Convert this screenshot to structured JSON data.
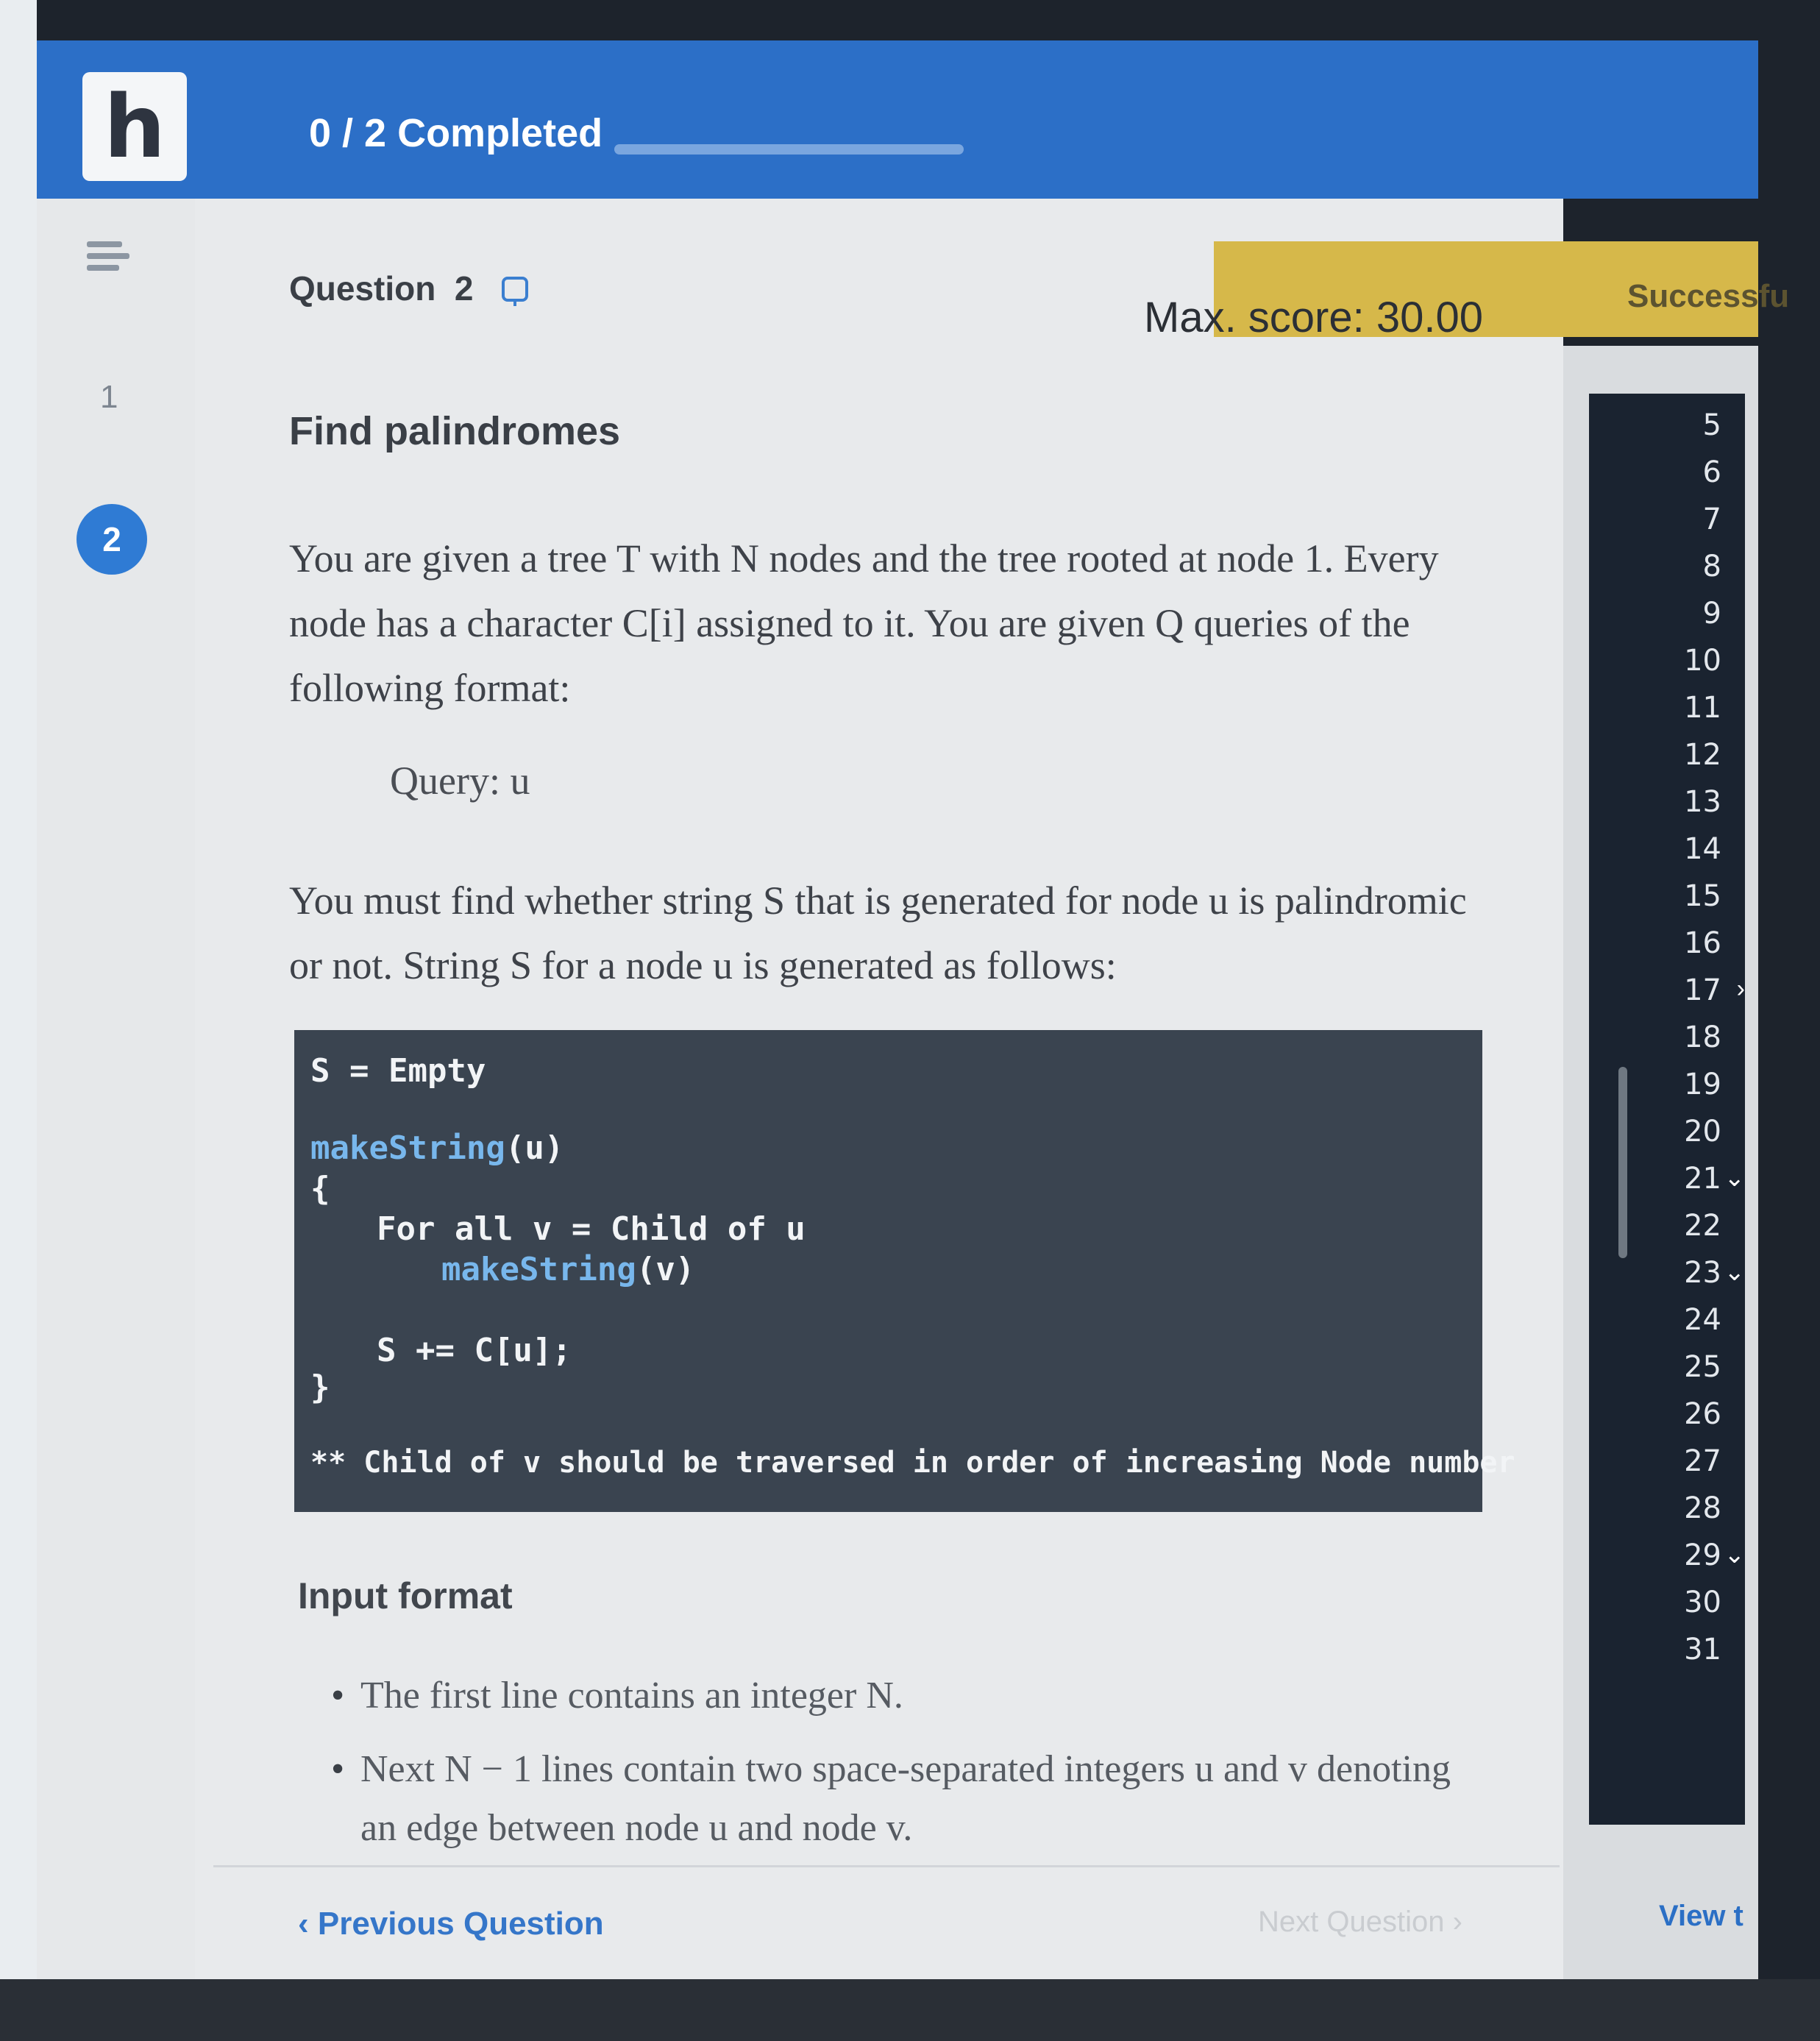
{
  "header": {
    "logo_letter": "h",
    "progress_label": "0 / 2 Completed",
    "progress_fraction": 0.0
  },
  "nav": {
    "questions": [
      "1",
      "2"
    ],
    "active_index": 1
  },
  "question": {
    "label": "Question",
    "number": "2",
    "max_score": "Max. score: 30.00",
    "status": "Successfu",
    "title": "Find palindromes",
    "para1": "You are given a tree T with N nodes and the tree rooted at node 1. Every node has a character C[i] assigned to it. You are given Q queries of the following format:",
    "query": "Query: u",
    "para2": "You must find whether string S that is generated for node u is palindromic or not. String S for a node u is generated as follows:",
    "code": {
      "line1": "S = Empty",
      "line2_fn": "makeString",
      "line2_arg": "(u)",
      "line3": "{",
      "line4": "For all v = Child of u",
      "line5_fn": "makeString",
      "line5_arg": "(v)",
      "line6": "S += C[u];",
      "line7": "}",
      "line8": "** Child of v should be traversed in order of increasing Node number"
    },
    "input_format_title": "Input format",
    "bullets": [
      "The first line contains an integer N.",
      "Next N − 1 lines contain two space-separated integers u and v denoting an edge between node u and node v."
    ]
  },
  "footer": {
    "prev": "‹ Previous Question",
    "next": "Next Question ›"
  },
  "editor": {
    "line_numbers": [
      "5",
      "6",
      "7",
      "8",
      "9",
      "10",
      "11",
      "12",
      "13",
      "14",
      "15",
      "16",
      "17",
      "18",
      "19",
      "20",
      "21",
      "22",
      "23",
      "24",
      "25",
      "26",
      "27",
      "28",
      "29",
      "30",
      "31"
    ],
    "view_link": "View t"
  }
}
